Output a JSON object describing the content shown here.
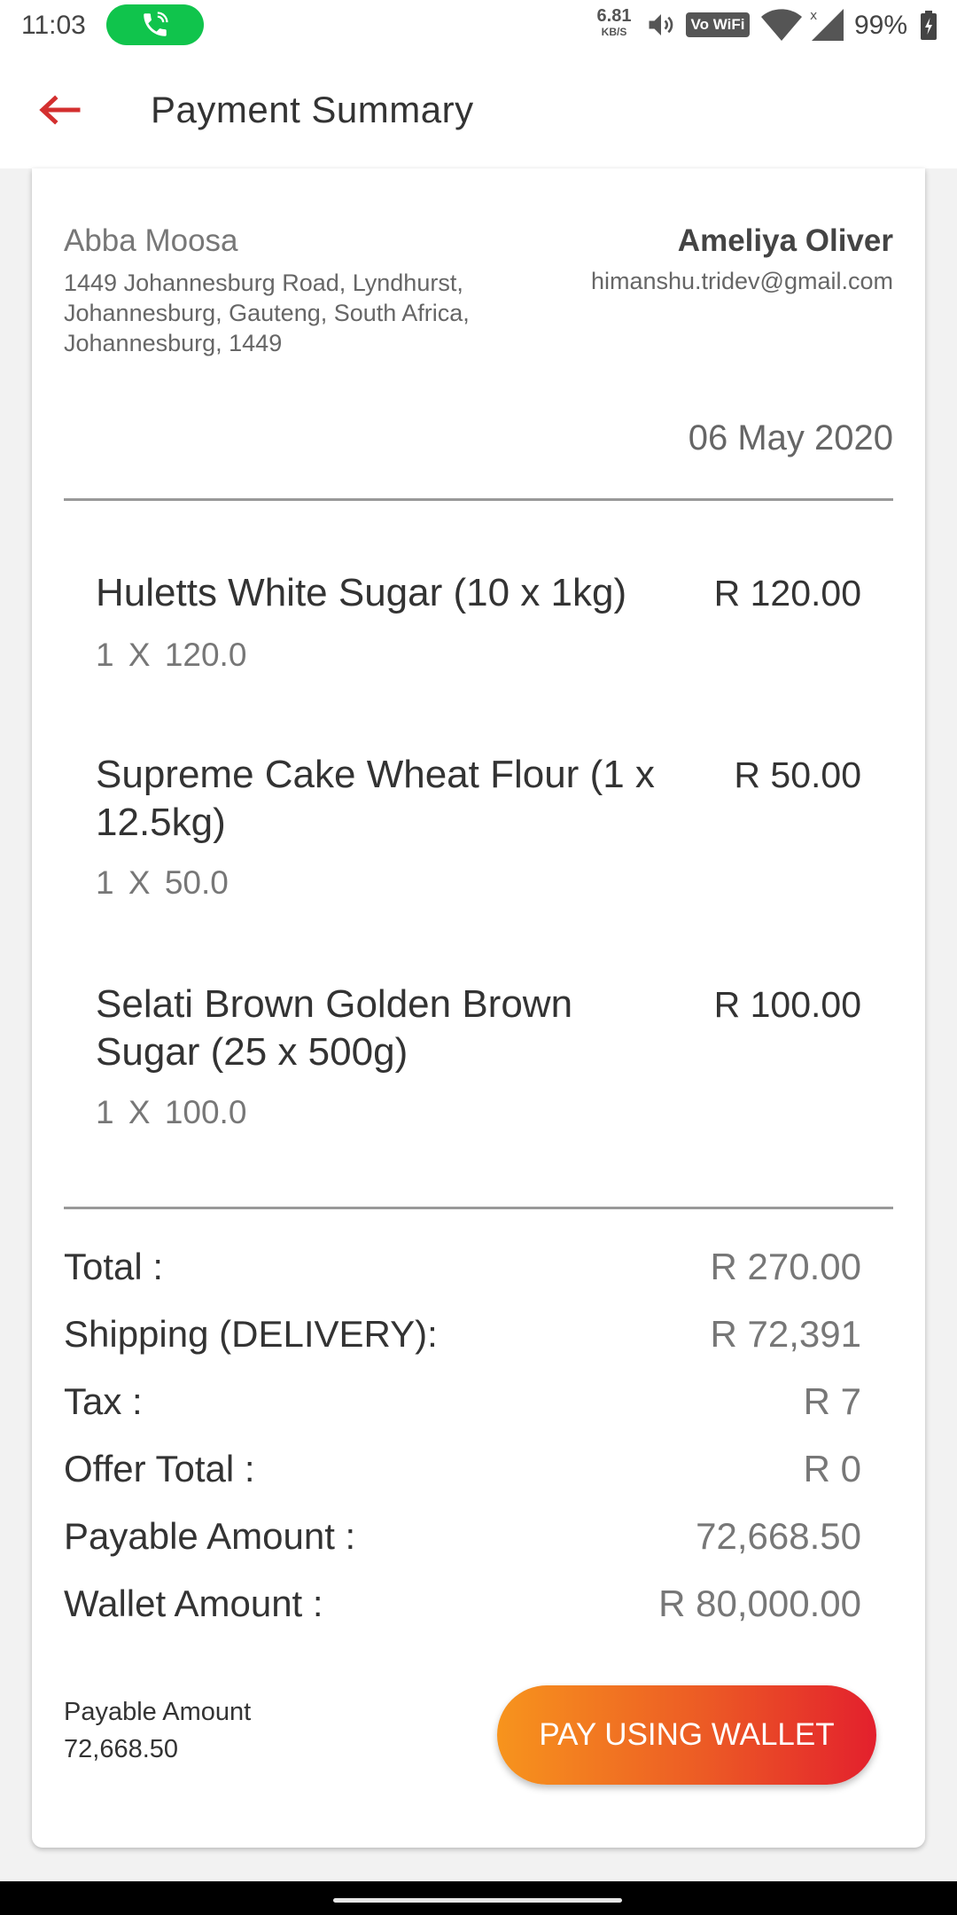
{
  "status_bar": {
    "time": "11:03",
    "net_speed": "6.81",
    "net_speed_unit": "KB/S",
    "volte_label": "Vo WiFi",
    "battery": "99%"
  },
  "header": {
    "title": "Payment Summary"
  },
  "sender": {
    "name": "Abba Moosa",
    "address": "1449 Johannesburg Road, Lyndhurst, Johannesburg, Gauteng, South Africa, Johannesburg, 1449"
  },
  "receiver": {
    "name": "Ameliya Oliver",
    "email": "himanshu.tridev@gmail.com"
  },
  "order_date": "06 May 2020",
  "items": [
    {
      "name": "Huletts White Sugar (10 x 1kg)",
      "price": "R 120.00",
      "qty": "1 X 120.0"
    },
    {
      "name": "Supreme Cake Wheat Flour (1 x 12.5kg)",
      "price": "R 50.00",
      "qty": "1 X 50.0"
    },
    {
      "name": "Selati Brown Golden Brown Sugar (25 x 500g)",
      "price": "R 100.00",
      "qty": "1 X 100.0"
    }
  ],
  "summary": [
    {
      "label": "Total :",
      "value": "R 270.00"
    },
    {
      "label": "Shipping (DELIVERY):",
      "value": "R 72,391"
    },
    {
      "label": "Tax :",
      "value": "R 7"
    },
    {
      "label": "Offer Total :",
      "value": "R 0"
    },
    {
      "label": "Payable Amount :",
      "value": "72,668.50"
    },
    {
      "label": "Wallet Amount :",
      "value": "R 80,000.00"
    }
  ],
  "footer": {
    "payable_label": "Payable Amount",
    "payable_value": "72,668.50",
    "pay_button": "PAY USING WALLET"
  },
  "colors": {
    "accent_red": "#d32f2f",
    "call_green": "#10c44c",
    "button_gradient_start": "#f7941d",
    "button_gradient_end": "#e3202d"
  },
  "icons": {
    "back": "arrow-left-icon",
    "call": "phone-call-icon",
    "volume": "volume-icon",
    "wifi": "wifi-icon",
    "signal": "cell-signal-icon",
    "battery": "battery-icon"
  }
}
